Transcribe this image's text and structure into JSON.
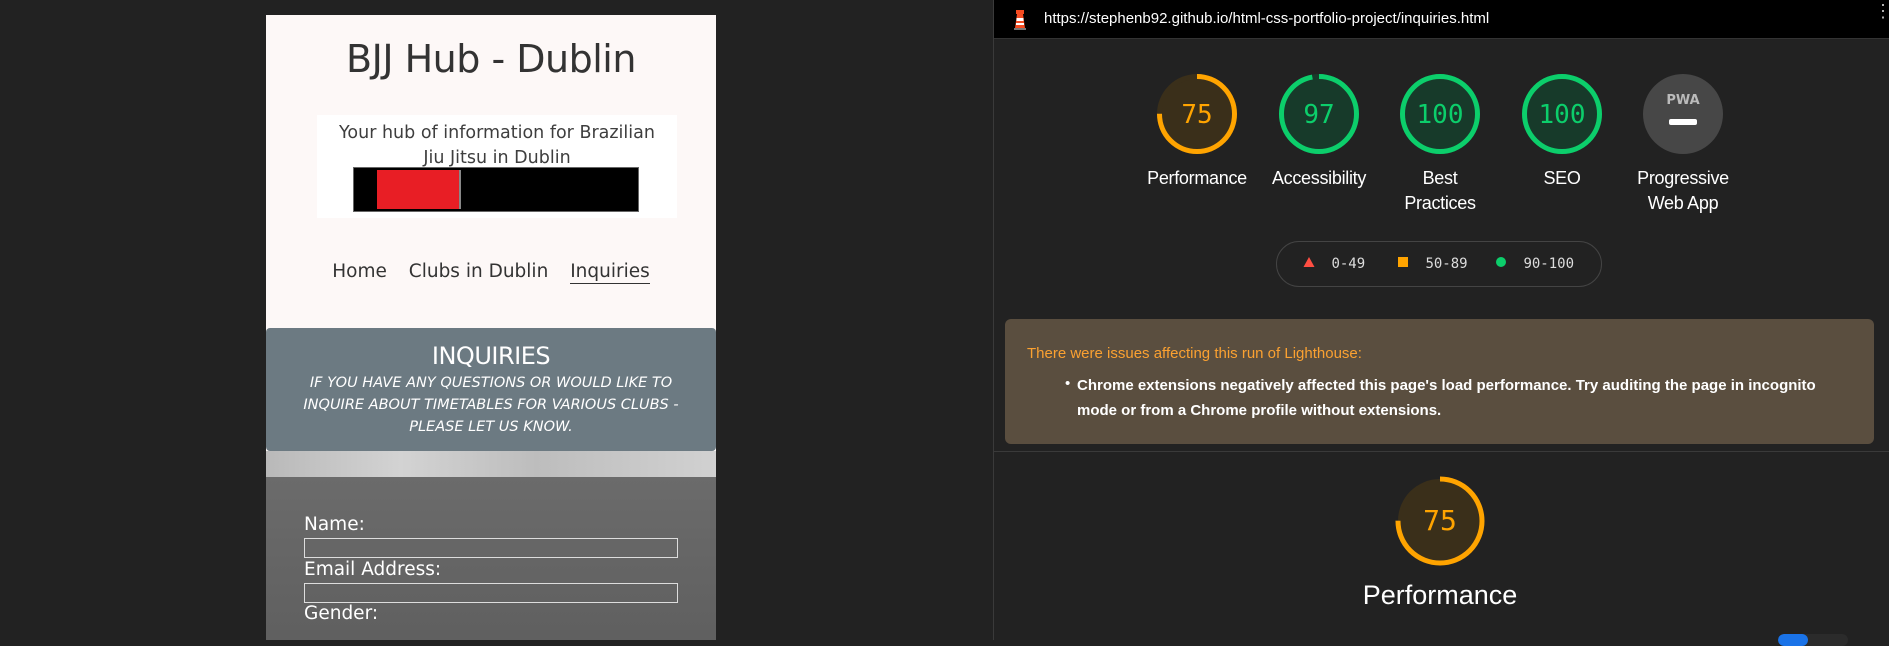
{
  "site": {
    "title": "BJJ Hub - Dublin",
    "tagline": "Your hub of information for Brazilian Jiu Jitsu in Dublin",
    "nav": [
      "Home",
      "Clubs in Dublin",
      "Inquiries"
    ],
    "active_nav": "Inquiries",
    "banner_title": "INQUIRIES",
    "banner_text": "If you have any questions or would like to inquire about timetables for various clubs - please let us know.",
    "form": {
      "name_label": "Name:",
      "email_label": "Email Address:",
      "gender_label": "Gender:"
    }
  },
  "lighthouse": {
    "url": "https://stephenb92.github.io/html-css-portfolio-project/inquiries.html",
    "gauges": [
      {
        "score": "75",
        "label": "Performance",
        "value": 75,
        "status": "average"
      },
      {
        "score": "97",
        "label": "Accessibility",
        "value": 97,
        "status": "pass"
      },
      {
        "score": "100",
        "label": "Best Practices",
        "value": 100,
        "status": "pass"
      },
      {
        "score": "100",
        "label": "SEO",
        "value": 100,
        "status": "pass"
      },
      {
        "score": "PWA",
        "label": "Progressive Web App",
        "value": null,
        "status": "na"
      }
    ],
    "legend": [
      "0-49",
      "50-89",
      "90-100"
    ],
    "warning_title": "There were issues affecting this run of Lighthouse:",
    "warning_item": "Chrome extensions negatively affected this page's load performance. Try auditing the page in incognito mode or from a Chrome profile without extensions.",
    "performance_score": "75",
    "performance_value": 75,
    "performance_label": "Performance"
  },
  "colors": {
    "fail": "#ff4e42",
    "average": "#ffa400",
    "pass": "#0cce6b",
    "warning_title": "#fba131",
    "site_belt_red": "#e81e25"
  }
}
